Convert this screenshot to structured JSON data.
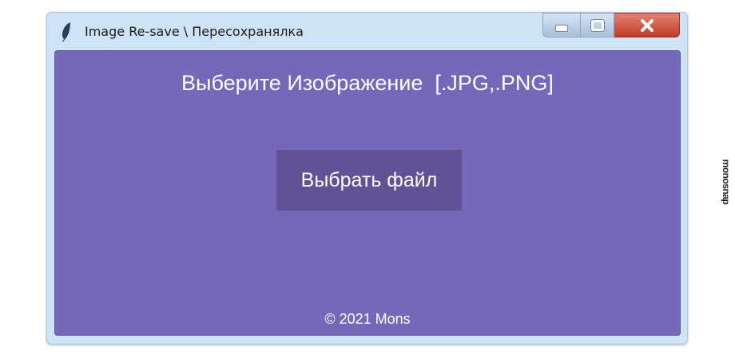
{
  "window": {
    "title": "Image Re-save \\ Пересохранялка",
    "app_icon": "feather-icon",
    "controls": {
      "minimize_icon": "minimize-icon",
      "maximize_icon": "maximize-icon",
      "close_icon": "close-icon",
      "close_label": "✕"
    }
  },
  "main": {
    "heading": "Выберите Изображение  [.JPG,.PNG]",
    "choose_button_label": "Выбрать файл",
    "footer": "© 2021 Mons"
  },
  "watermark": {
    "text": "monosnap"
  },
  "colors": {
    "client_background": "#7567b9",
    "button_background": "#625295",
    "titlebar_background": "#cfe3f7",
    "close_button": "#c23a25"
  }
}
